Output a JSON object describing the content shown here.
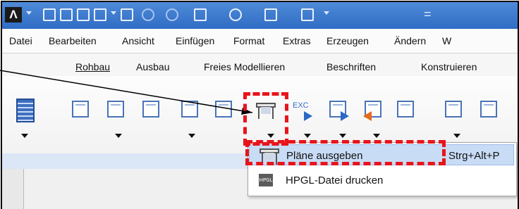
{
  "quick_access": {
    "logo_text": "Λ",
    "customize_glyph": "="
  },
  "menubar": {
    "items": [
      {
        "label": "Datei"
      },
      {
        "label": "Bearbeiten"
      },
      {
        "label": "Ansicht"
      },
      {
        "label": "Einfügen"
      },
      {
        "label": "Format"
      },
      {
        "label": "Extras"
      },
      {
        "label": "Erzeugen"
      },
      {
        "label": "Ändern"
      },
      {
        "label": "W"
      }
    ]
  },
  "ribbon_tabs": {
    "items": [
      {
        "label": "Rohbau"
      },
      {
        "label": "Ausbau"
      },
      {
        "label": "Freies Modellieren"
      },
      {
        "label": "Beschriften"
      },
      {
        "label": "Konstruieren"
      }
    ]
  },
  "ribbon": {
    "exc_label": "EXC"
  },
  "dropdown": {
    "items": [
      {
        "label": "Pläne ausgeben",
        "shortcut": "Strg+Alt+P",
        "icon": "plotter-icon"
      },
      {
        "label": "HPGL-Datei drucken",
        "shortcut": "",
        "icon": "hpgl-icon"
      }
    ],
    "hpgl_icon_text": "HPGL"
  },
  "annotations": {
    "highlight_color": "#e8141b",
    "pointer_color": "#000000"
  }
}
